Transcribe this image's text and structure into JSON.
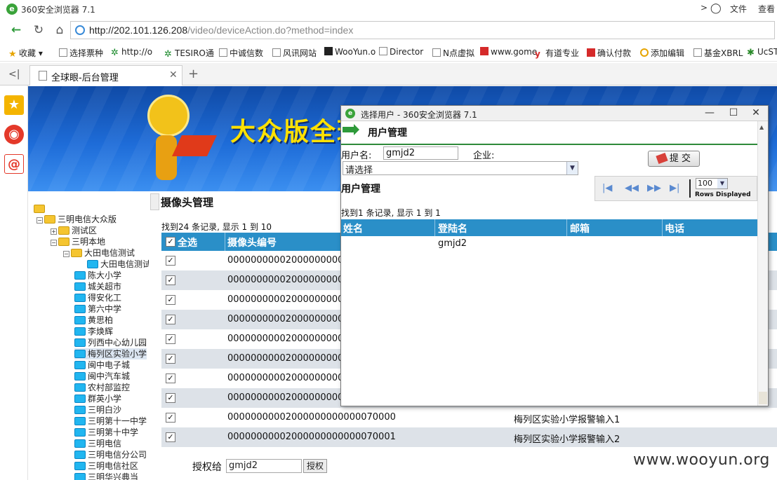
{
  "browser": {
    "title": "360安全浏览器 7.1",
    "menu_file": "文件",
    "menu_view": "查看",
    "url_base": "http://202.101.126.208",
    "url_path": "/video/deviceAction.do?method=index",
    "tab_title": "全球眼-后台管理",
    "bookmarks": [
      "收藏",
      "选择票种",
      "http://o",
      "TESIRO通",
      "中诚信数",
      "风讯网站",
      "WooYun.o",
      "Director",
      "N点虚拟",
      "www.gome",
      "有道专业",
      "确认付款",
      "添加编辑",
      "基金XBRL",
      "UcST..."
    ]
  },
  "banner": {
    "title": "大众版全球"
  },
  "tree": {
    "nodes": [
      "三明电信大众版",
      "测试区",
      "三明本地",
      "大田电信测试",
      "大田电信测试",
      "陈大小学",
      "城关超市",
      "得安化工",
      "第六中学",
      "黄思柏",
      "李焕辉",
      "列西中心幼儿园",
      "梅列区实验小学",
      "闽中电子城",
      "闽中汽车城",
      "农村部监控",
      "群英小学",
      "三明白沙",
      "三明第十一中学",
      "三明第十中学",
      "三明电信",
      "三明电信分公司",
      "三明电信社区",
      "三明华兴典当"
    ]
  },
  "main": {
    "heading": "摄像头管理",
    "found": "找到24 条记录, 显示  1 到  10",
    "col_select_all": "全选",
    "col_camera_no": "摄像头编号",
    "rows": [
      {
        "id": "000000000020000000000000",
        "name": ""
      },
      {
        "id": "000000000020000000000000",
        "name": ""
      },
      {
        "id": "000000000020000000000000",
        "name": ""
      },
      {
        "id": "000000000020000000000000",
        "name": ""
      },
      {
        "id": "000000000020000000000000",
        "name": ""
      },
      {
        "id": "000000000020000000000000",
        "name": ""
      },
      {
        "id": "000000000020000000000000",
        "name": ""
      },
      {
        "id": "000000000020000000000000",
        "name": ""
      },
      {
        "id": "00000000002000000000000070000",
        "name": "梅列区实验小学报警输入1"
      },
      {
        "id": "00000000002000000000000070001",
        "name": "梅列区实验小学报警输入2"
      }
    ],
    "grant_label": "授权给",
    "grant_value": "gmjd2",
    "grant_button": "授权",
    "watermark": "www.wooyun.org"
  },
  "popup": {
    "window_title": "选择用户 - 360安全浏览器 7.1",
    "header": "用户管理",
    "username_label": "用户名:",
    "username_value": "gmjd2",
    "company_label": "企业:",
    "submit_label": "提 交",
    "select_value": "请选择",
    "section_title": "用户管理",
    "rows_value": "100",
    "rows_label": "Rows Displayed",
    "found": "找到1 条记录, 显示  1 到  1",
    "columns": [
      "姓名",
      "登陆名",
      "邮箱",
      "电话"
    ],
    "rows": [
      {
        "name": "",
        "login": "gmjd2",
        "email": "",
        "phone": ""
      }
    ]
  }
}
